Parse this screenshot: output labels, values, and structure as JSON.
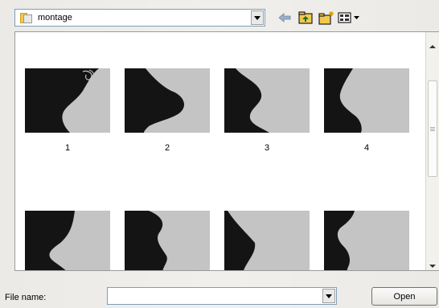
{
  "look_in": {
    "folder_name": "montage"
  },
  "toolbar": {
    "back_icon": "back-arrow-icon",
    "up_icon": "up-one-level-icon",
    "new_folder_icon": "new-folder-icon",
    "views_icon": "views-menu-icon"
  },
  "thumbnails": [
    {
      "label": "1",
      "image": "edge-profile-1"
    },
    {
      "label": "2",
      "image": "edge-profile-2"
    },
    {
      "label": "3",
      "image": "edge-profile-3"
    },
    {
      "label": "4",
      "image": "edge-profile-4"
    },
    {
      "label": "",
      "image": "edge-profile-5"
    },
    {
      "label": "",
      "image": "edge-profile-6"
    },
    {
      "label": "",
      "image": "edge-profile-7"
    },
    {
      "label": "",
      "image": "edge-profile-8"
    }
  ],
  "footer": {
    "file_name_label": "File name:",
    "file_name_value": "",
    "open_label": "Open"
  },
  "colors": {
    "dialog_bg": "#eceae6",
    "thumb_dark": "#141414",
    "thumb_light": "#c4c4c4",
    "folder_yellow": "#f2c94c"
  }
}
